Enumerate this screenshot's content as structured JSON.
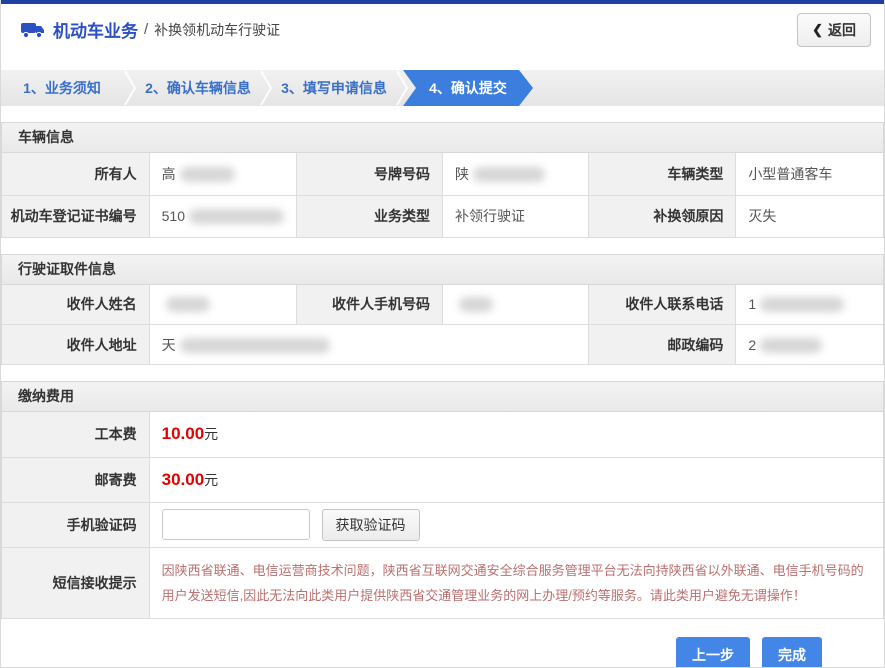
{
  "header": {
    "title": "机动车业务",
    "separator": "/",
    "subtitle": "补换领机动车行驶证",
    "back_label": "返回",
    "back_chevron": "❮"
  },
  "steps": [
    {
      "label": "1、业务须知",
      "active": false
    },
    {
      "label": "2、确认车辆信息",
      "active": false
    },
    {
      "label": "3、填写申请信息",
      "active": false
    },
    {
      "label": "4、确认提交",
      "active": true
    }
  ],
  "vehicle_info": {
    "title": "车辆信息",
    "owner_label": "所有人",
    "owner_value": "高",
    "plate_label": "号牌号码",
    "plate_value": "陕",
    "vehicle_type_label": "车辆类型",
    "vehicle_type_value": "小型普通客车",
    "cert_no_label": "机动车登记证书编号",
    "cert_no_value": "510",
    "business_type_label": "业务类型",
    "business_type_value": "补领行驶证",
    "reason_label": "补换领原因",
    "reason_value": "灭失"
  },
  "pickup_info": {
    "title": "行驶证取件信息",
    "recipient_name_label": "收件人姓名",
    "recipient_name_value": "",
    "recipient_mobile_label": "收件人手机号码",
    "recipient_mobile_value": "",
    "recipient_phone_label": "收件人联系电话",
    "recipient_phone_value": "1",
    "recipient_address_label": "收件人地址",
    "recipient_address_value": "天",
    "postcode_label": "邮政编码",
    "postcode_value": "2"
  },
  "payment": {
    "title": "缴纳费用",
    "cost_label": "工本费",
    "cost_value": "10.00",
    "cost_unit": "元",
    "postage_label": "邮寄费",
    "postage_value": "30.00",
    "postage_unit": "元",
    "captcha_label": "手机验证码",
    "captcha_input_value": "",
    "captcha_button_label": "获取验证码",
    "sms_tip_label": "短信接收提示",
    "sms_tip_text": "因陕西省联通、电信运营商技术问题，陕西省互联网交通安全综合服务管理平台无法向持陕西省以外联通、电信手机号码的用户发送短信,因此无法向此类用户提供陕西省交通管理业务的网上办理/预约等服务。请此类用户避免无谓操作！"
  },
  "footer": {
    "prev_label": "上一步",
    "finish_label": "完成"
  },
  "colors": {
    "top_bar": "#1e41a4",
    "title_blue": "#2b50c4",
    "step_active_blue": "#3b7edd",
    "price_red": "#e60000",
    "warning_red": "#bb6f6f",
    "button_blue": "#4486e8"
  }
}
